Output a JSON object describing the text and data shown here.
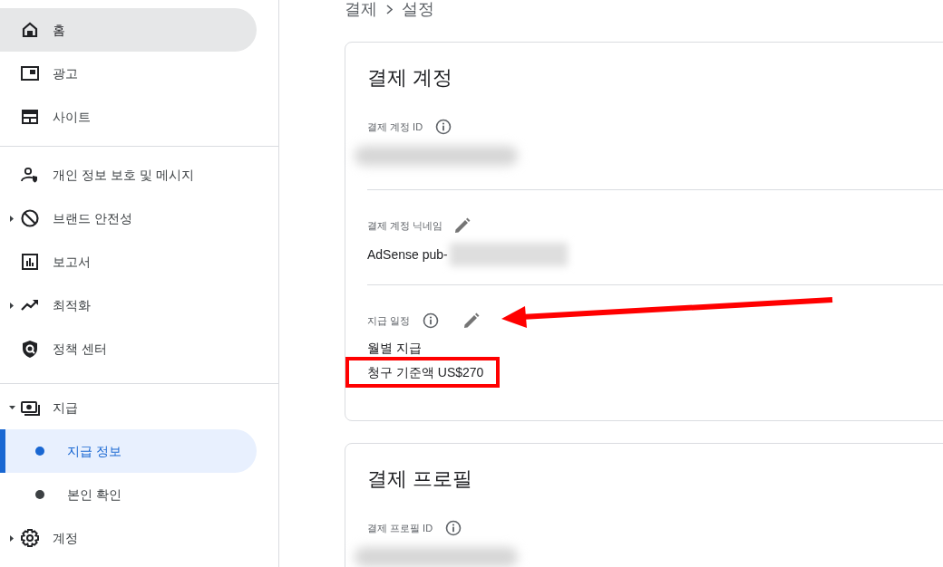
{
  "sidebar": {
    "sections": [
      {
        "items": [
          {
            "kind": "item",
            "label": "홈",
            "selected": true
          },
          {
            "kind": "item",
            "label": "광고",
            "selected": false
          },
          {
            "kind": "item",
            "label": "사이트",
            "selected": false
          }
        ]
      },
      {
        "items": [
          {
            "kind": "item",
            "label": "개인 정보 보호 및 메시지",
            "selected": false
          },
          {
            "kind": "item",
            "label": "브랜드 안전성",
            "selected": false,
            "expanded": false
          },
          {
            "kind": "item",
            "label": "보고서",
            "selected": false
          },
          {
            "kind": "item",
            "label": "최적화",
            "selected": false,
            "expanded": false
          },
          {
            "kind": "item",
            "label": "정책 센터",
            "selected": false
          }
        ]
      },
      {
        "items": [
          {
            "kind": "item",
            "label": "지급",
            "selected": false,
            "expanded": true
          },
          {
            "kind": "sub",
            "label": "지급 정보",
            "selected": true
          },
          {
            "kind": "sub",
            "label": "본인 확인",
            "selected": false
          },
          {
            "kind": "item",
            "label": "계정",
            "selected": false,
            "expanded": false
          }
        ]
      }
    ]
  },
  "breadcrumb": [
    "결제",
    "설정"
  ],
  "cards": [
    {
      "title": "결제 계정",
      "fields": [
        {
          "label": "결제 계정 ID",
          "info": true,
          "editable": false,
          "redacted": true
        },
        {
          "label": "결제 계정 닉네임",
          "info": false,
          "editable": true,
          "redacted": true,
          "values": [
            {
              "text": "AdSense pub-",
              "highlighted": false
            }
          ]
        },
        {
          "label": "지급 일정",
          "info": true,
          "editable": true,
          "redacted": false,
          "values": [
            {
              "text": "월별 지급",
              "highlighted": false
            },
            {
              "text": "청구 기준액 US$270",
              "highlighted": true
            }
          ]
        }
      ]
    },
    {
      "title": "결제 프로필",
      "fields": [
        {
          "label": "결제 프로필 ID",
          "info": true,
          "editable": false,
          "redacted": true
        }
      ]
    }
  ]
}
